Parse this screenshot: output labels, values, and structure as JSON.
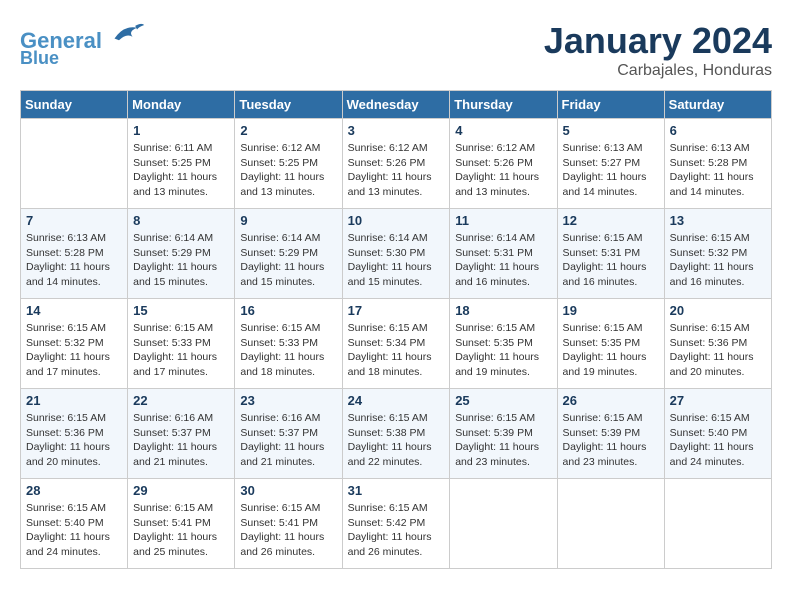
{
  "header": {
    "logo_line1": "General",
    "logo_line2": "Blue",
    "month": "January 2024",
    "location": "Carbajales, Honduras"
  },
  "columns": [
    "Sunday",
    "Monday",
    "Tuesday",
    "Wednesday",
    "Thursday",
    "Friday",
    "Saturday"
  ],
  "weeks": [
    [
      {
        "day": "",
        "info": ""
      },
      {
        "day": "1",
        "info": "Sunrise: 6:11 AM\nSunset: 5:25 PM\nDaylight: 11 hours\nand 13 minutes."
      },
      {
        "day": "2",
        "info": "Sunrise: 6:12 AM\nSunset: 5:25 PM\nDaylight: 11 hours\nand 13 minutes."
      },
      {
        "day": "3",
        "info": "Sunrise: 6:12 AM\nSunset: 5:26 PM\nDaylight: 11 hours\nand 13 minutes."
      },
      {
        "day": "4",
        "info": "Sunrise: 6:12 AM\nSunset: 5:26 PM\nDaylight: 11 hours\nand 13 minutes."
      },
      {
        "day": "5",
        "info": "Sunrise: 6:13 AM\nSunset: 5:27 PM\nDaylight: 11 hours\nand 14 minutes."
      },
      {
        "day": "6",
        "info": "Sunrise: 6:13 AM\nSunset: 5:28 PM\nDaylight: 11 hours\nand 14 minutes."
      }
    ],
    [
      {
        "day": "7",
        "info": "Sunrise: 6:13 AM\nSunset: 5:28 PM\nDaylight: 11 hours\nand 14 minutes."
      },
      {
        "day": "8",
        "info": "Sunrise: 6:14 AM\nSunset: 5:29 PM\nDaylight: 11 hours\nand 15 minutes."
      },
      {
        "day": "9",
        "info": "Sunrise: 6:14 AM\nSunset: 5:29 PM\nDaylight: 11 hours\nand 15 minutes."
      },
      {
        "day": "10",
        "info": "Sunrise: 6:14 AM\nSunset: 5:30 PM\nDaylight: 11 hours\nand 15 minutes."
      },
      {
        "day": "11",
        "info": "Sunrise: 6:14 AM\nSunset: 5:31 PM\nDaylight: 11 hours\nand 16 minutes."
      },
      {
        "day": "12",
        "info": "Sunrise: 6:15 AM\nSunset: 5:31 PM\nDaylight: 11 hours\nand 16 minutes."
      },
      {
        "day": "13",
        "info": "Sunrise: 6:15 AM\nSunset: 5:32 PM\nDaylight: 11 hours\nand 16 minutes."
      }
    ],
    [
      {
        "day": "14",
        "info": "Sunrise: 6:15 AM\nSunset: 5:32 PM\nDaylight: 11 hours\nand 17 minutes."
      },
      {
        "day": "15",
        "info": "Sunrise: 6:15 AM\nSunset: 5:33 PM\nDaylight: 11 hours\nand 17 minutes."
      },
      {
        "day": "16",
        "info": "Sunrise: 6:15 AM\nSunset: 5:33 PM\nDaylight: 11 hours\nand 18 minutes."
      },
      {
        "day": "17",
        "info": "Sunrise: 6:15 AM\nSunset: 5:34 PM\nDaylight: 11 hours\nand 18 minutes."
      },
      {
        "day": "18",
        "info": "Sunrise: 6:15 AM\nSunset: 5:35 PM\nDaylight: 11 hours\nand 19 minutes."
      },
      {
        "day": "19",
        "info": "Sunrise: 6:15 AM\nSunset: 5:35 PM\nDaylight: 11 hours\nand 19 minutes."
      },
      {
        "day": "20",
        "info": "Sunrise: 6:15 AM\nSunset: 5:36 PM\nDaylight: 11 hours\nand 20 minutes."
      }
    ],
    [
      {
        "day": "21",
        "info": "Sunrise: 6:15 AM\nSunset: 5:36 PM\nDaylight: 11 hours\nand 20 minutes."
      },
      {
        "day": "22",
        "info": "Sunrise: 6:16 AM\nSunset: 5:37 PM\nDaylight: 11 hours\nand 21 minutes."
      },
      {
        "day": "23",
        "info": "Sunrise: 6:16 AM\nSunset: 5:37 PM\nDaylight: 11 hours\nand 21 minutes."
      },
      {
        "day": "24",
        "info": "Sunrise: 6:15 AM\nSunset: 5:38 PM\nDaylight: 11 hours\nand 22 minutes."
      },
      {
        "day": "25",
        "info": "Sunrise: 6:15 AM\nSunset: 5:39 PM\nDaylight: 11 hours\nand 23 minutes."
      },
      {
        "day": "26",
        "info": "Sunrise: 6:15 AM\nSunset: 5:39 PM\nDaylight: 11 hours\nand 23 minutes."
      },
      {
        "day": "27",
        "info": "Sunrise: 6:15 AM\nSunset: 5:40 PM\nDaylight: 11 hours\nand 24 minutes."
      }
    ],
    [
      {
        "day": "28",
        "info": "Sunrise: 6:15 AM\nSunset: 5:40 PM\nDaylight: 11 hours\nand 24 minutes."
      },
      {
        "day": "29",
        "info": "Sunrise: 6:15 AM\nSunset: 5:41 PM\nDaylight: 11 hours\nand 25 minutes."
      },
      {
        "day": "30",
        "info": "Sunrise: 6:15 AM\nSunset: 5:41 PM\nDaylight: 11 hours\nand 26 minutes."
      },
      {
        "day": "31",
        "info": "Sunrise: 6:15 AM\nSunset: 5:42 PM\nDaylight: 11 hours\nand 26 minutes."
      },
      {
        "day": "",
        "info": ""
      },
      {
        "day": "",
        "info": ""
      },
      {
        "day": "",
        "info": ""
      }
    ]
  ]
}
